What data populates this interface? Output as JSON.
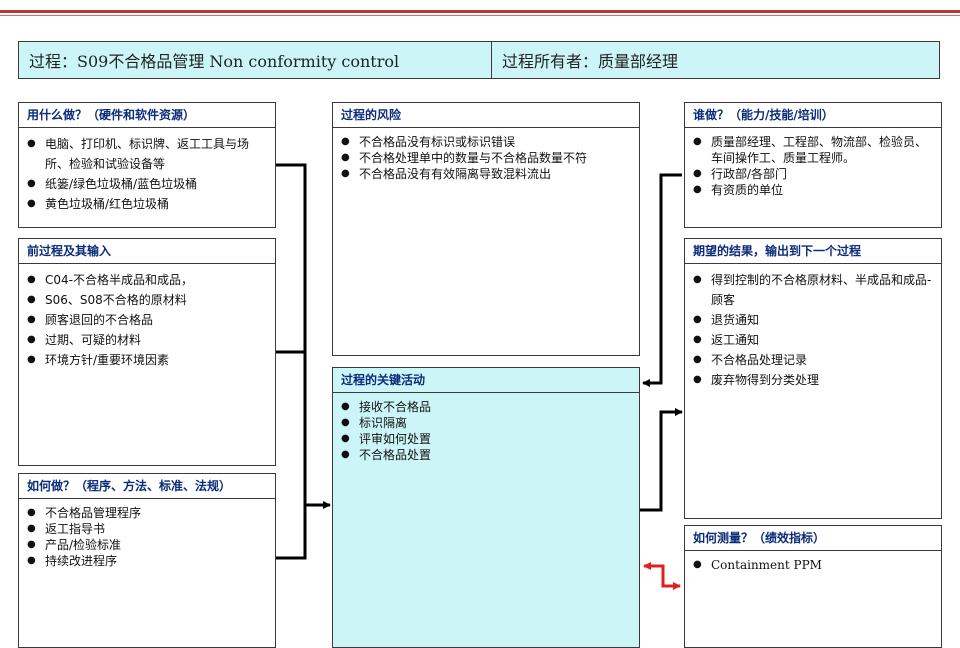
{
  "header": {
    "process": "过程：S09不合格品管理 Non conformity control",
    "owner": "过程所有者：质量部经理"
  },
  "boxes": {
    "resources": {
      "title": "用什么做？（硬件和软件资源）",
      "items": [
        "电脑、打印机、标识牌、返工工具与场所、检验和试验设备等",
        "纸篓/绿色垃圾桶/蓝色垃圾桶",
        "黄色垃圾桶/红色垃圾桶"
      ]
    },
    "inputs": {
      "title": "前过程及其输入",
      "items": [
        "C04-不合格半成品和成品，",
        "S06、S08不合格的原材料",
        "顾客退回的不合格品",
        "过期、可疑的材料",
        "环境方针/重要环境因素"
      ]
    },
    "methods": {
      "title": "如何做？（程序、方法、标准、法规）",
      "items": [
        "不合格品管理程序",
        "返工指导书",
        "产品/检验标准",
        "持续改进程序"
      ]
    },
    "risks": {
      "title": "过程的风险",
      "items": [
        "不合格品没有标识或标识错误",
        "不合格处理单中的数量与不合格品数量不符",
        "不合格品没有有效隔离导致混料流出"
      ]
    },
    "activities": {
      "title": "过程的关键活动",
      "items": [
        "接收不合格品",
        "标识隔离",
        "评审如何处置",
        "不合格品处置"
      ]
    },
    "who": {
      "title": "谁做？（能力/技能/培训）",
      "items": [
        "质量部经理、工程部、物流部、检验员、车间操作工、质量工程师。",
        "行政部/各部门",
        "有资质的单位"
      ]
    },
    "outputs": {
      "title": "期望的结果，输出到下一个过程",
      "items": [
        "得到控制的不合格原材料、半成品和成品-顾客",
        "退货通知",
        "返工通知",
        "不合格品处理记录",
        "废弃物得到分类处理"
      ]
    },
    "measure": {
      "title": "如何测量？（绩效指标）",
      "items": [
        "Containment PPM"
      ]
    }
  },
  "colors": {
    "header_bg": "#ccf5f8",
    "title_text": "#0b2c7a",
    "kpi_arrow": "#e02020",
    "top_rule": "#b23a3a"
  }
}
